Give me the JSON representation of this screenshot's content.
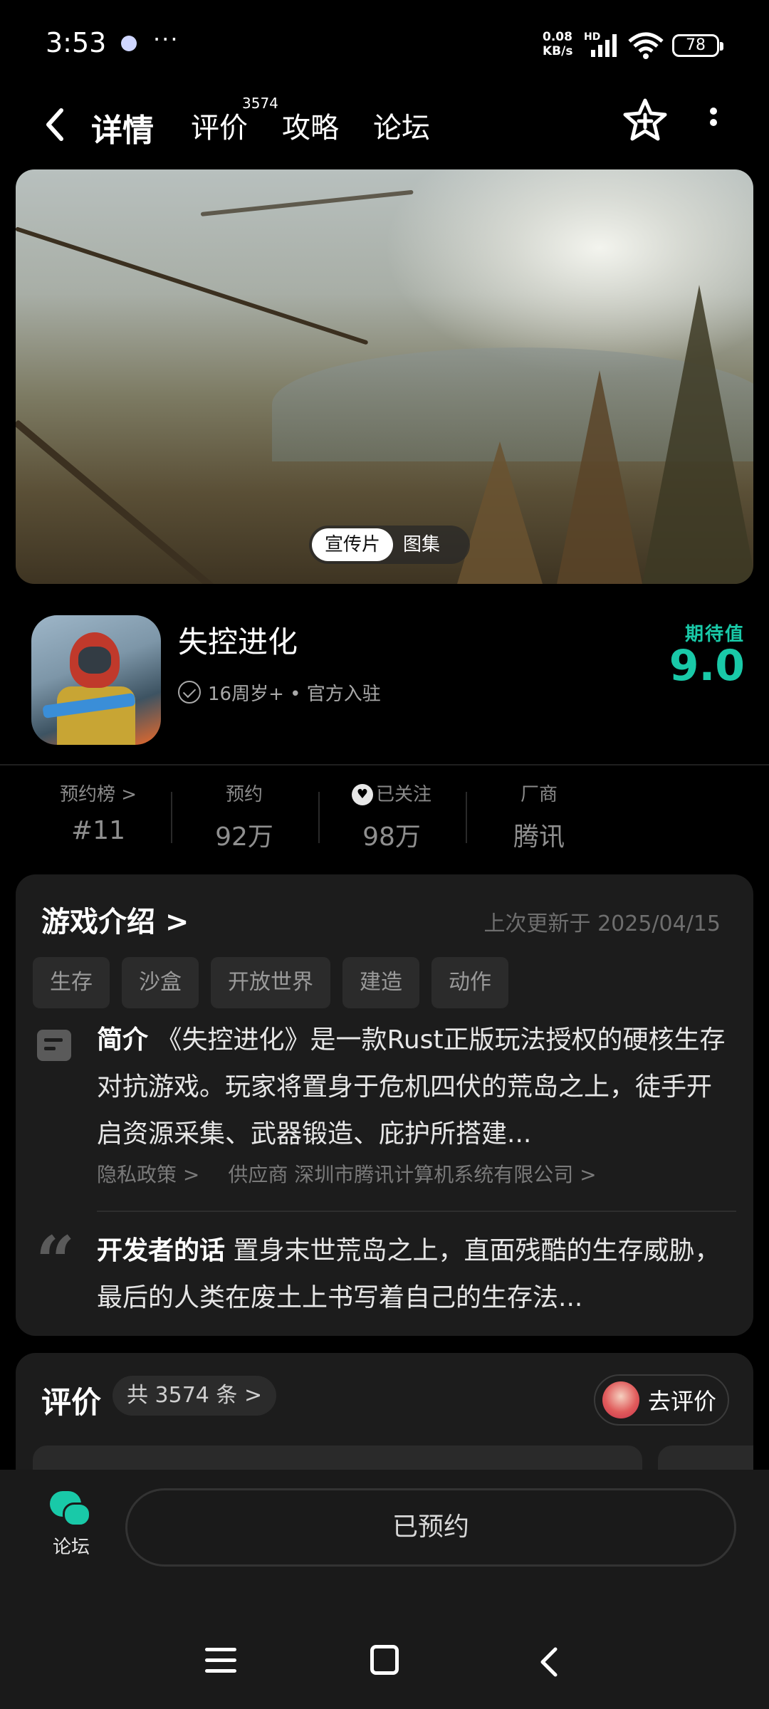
{
  "status_bar": {
    "time": "3:53",
    "more": "···",
    "net_speed_value": "0.08",
    "net_speed_unit": "KB/s",
    "hd": "HD",
    "battery": "78"
  },
  "header": {
    "tabs": [
      {
        "label": "详情"
      },
      {
        "label": "评价",
        "badge": "3574"
      },
      {
        "label": "攻略"
      },
      {
        "label": "论坛"
      }
    ]
  },
  "hero": {
    "video_label": "宣传片",
    "gallery_label": "图集"
  },
  "game": {
    "title": "失控进化",
    "meta": "16周岁+ • 官方入驻",
    "expect_label": "期待值",
    "expect_score": "9.0"
  },
  "stats": [
    {
      "label": "预约榜 >",
      "value": "#11"
    },
    {
      "label": "预约",
      "value": "92万"
    },
    {
      "label": "已关注",
      "value": "98万"
    },
    {
      "label": "厂商",
      "value": "腾讯"
    }
  ],
  "intro": {
    "title": "游戏介绍 >",
    "updated": "上次更新于 2025/04/15",
    "tags": [
      "生存",
      "沙盒",
      "开放世界",
      "建造",
      "动作"
    ],
    "summary_label": "简介",
    "summary_text": "《失控进化》是一款Rust正版玩法授权的硬核生存对抗游戏。玩家将置身于危机四伏的荒岛之上，徒手开启资源采集、武器锻造、庇护所搭建...",
    "privacy": "隐私政策 >",
    "provider": "供应商 深圳市腾讯计算机系统有限公司 >",
    "dev_label": "开发者的话",
    "dev_text": "置身末世荒岛之上，直面残酷的生存威胁，最后的人类在废土上书写着自己的生存法..."
  },
  "reviews": {
    "title": "评价",
    "count": "共 3574 条 >",
    "write_label": "去评价"
  },
  "bottom": {
    "forum_label": "论坛",
    "reserved_label": "已预约"
  },
  "colors": {
    "accent": "#19c9a8",
    "background": "#000000",
    "card": "#1c1c1c"
  }
}
